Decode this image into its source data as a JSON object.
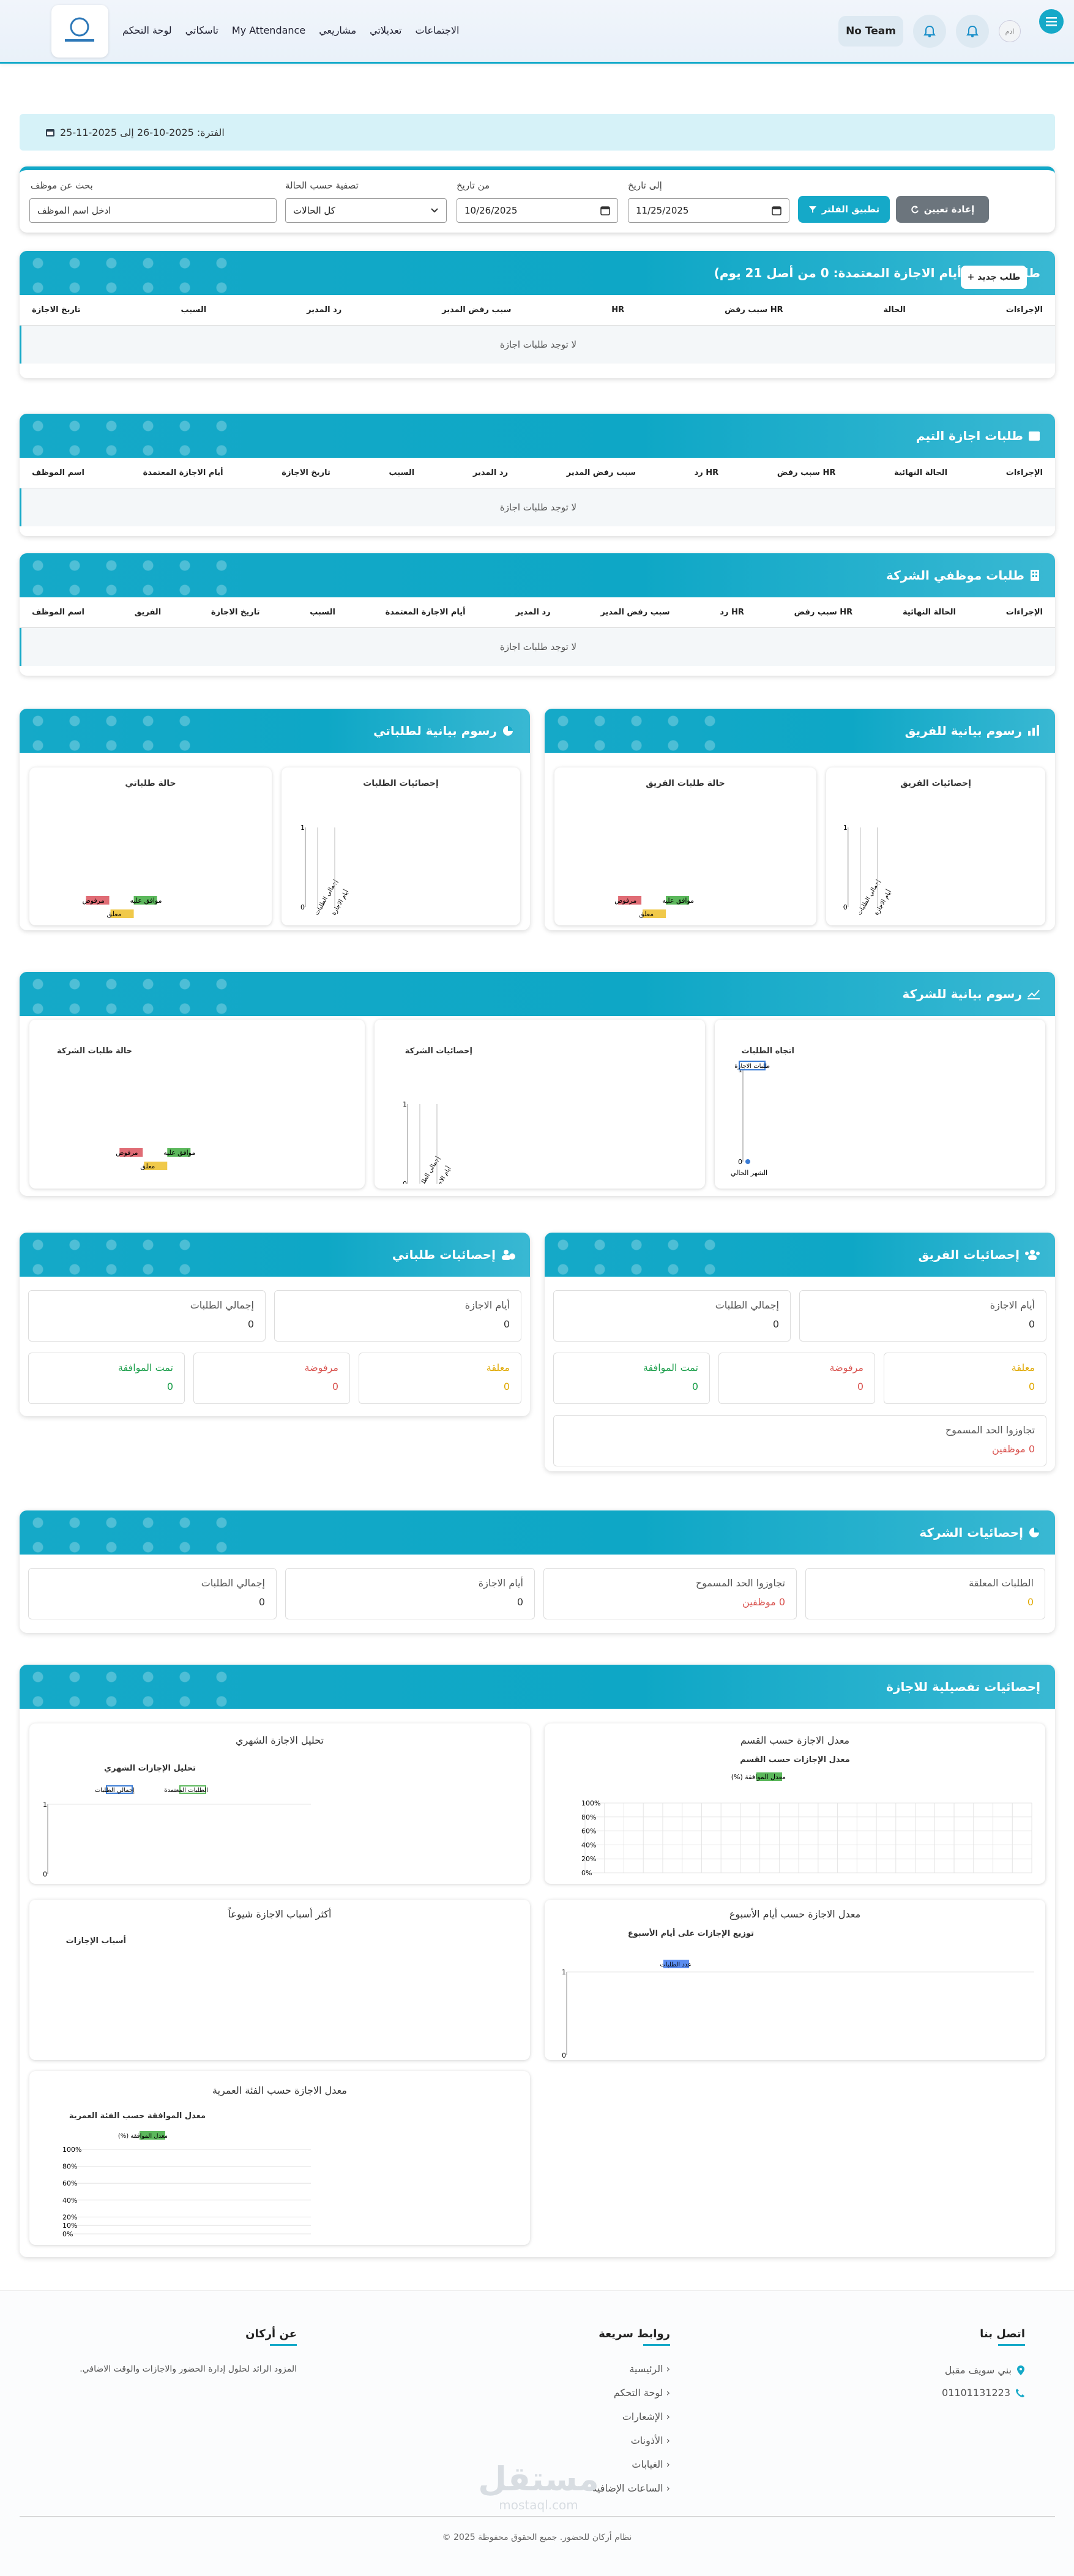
{
  "header": {
    "nav": [
      "الاجتماعات",
      "تعديلاتي",
      "مشاريعي",
      "My Attendance",
      "تاسكاتي",
      "لوحة التحكم"
    ],
    "team_label": "No Team",
    "user_initials": "ادم"
  },
  "period": "الفترة: 2025-10-26 إلى 2025-11-25",
  "filter": {
    "search_label": "بحث عن موظف",
    "search_placeholder": "ادخل اسم الموظف",
    "status_label": "تصفية حسب الحالة",
    "status_value": "كل الحالات",
    "from_label": "من تاريخ",
    "from_value": "10/26/2025",
    "to_label": "إلى تاريخ",
    "to_value": "11/25/2025",
    "apply": "تطبيق الفلتر",
    "reset": "إعادة تعيين"
  },
  "my_requests": {
    "title": "طلباتي (عدد أيام الاجازة المعتمدة: 0 من أصل 21 يوم)",
    "new_button": "طلب جديد +",
    "columns": [
      "الإجراءات",
      "الحالة",
      "HR سبب رفض",
      "HR",
      "سبب رفض المدير",
      "رد المدير",
      "السبب",
      "تاريخ الاجازة"
    ],
    "empty": "لا توجد طلبات اجازة"
  },
  "team_requests": {
    "title": "طلبات اجازة التيم",
    "columns": [
      "الإجراءات",
      "الحالة النهائية",
      "HR سبب رفض",
      "HR رد",
      "سبب رفض المدير",
      "رد المدير",
      "السبب",
      "تاريخ الاجازة",
      "أيام الاجازة المعتمدة",
      "اسم الموظف"
    ],
    "empty": "لا توجد طلبات اجازة"
  },
  "company_requests": {
    "title": "طلبات موظفي الشركة",
    "columns": [
      "الإجراءات",
      "الحالة النهائية",
      "HR سبب رفض",
      "HR رد",
      "سبب رفض المدير",
      "رد المدير",
      "أيام الاجازة المعتمدة",
      "السبب",
      "تاريخ الاجازة",
      "الفريق",
      "اسم الموظف"
    ],
    "empty": "لا توجد طلبات اجازة"
  },
  "charts_team": {
    "title": "رسوم بيانية للفريق",
    "stats_title": "إحصائيات الفريق",
    "status_title": "حالة طلبات الفريق"
  },
  "charts_mine": {
    "title": "رسوم بيانية لطلباتي",
    "stats_title": "إحصائيات الطلبات",
    "status_title": "حالة طلباتي"
  },
  "charts_company": {
    "title": "رسوم بيانية للشركة",
    "trend_title": "اتجاه الطلبات",
    "trend_legend": "طلبات الاجازة",
    "trend_xlabel": "الشهر الحالي",
    "stats_title": "إحصائيات الشركة",
    "status_title": "حالة طلبات الشركة"
  },
  "bar_labels": [
    "إجمالي الطلبات",
    "أيام الاجازة"
  ],
  "legend_status": {
    "approved": "موافق عليه",
    "rejected": "مرفوض",
    "pending": "معلق"
  },
  "team_stats": {
    "title": "إحصائيات الفريق",
    "days": "أيام الاجازة",
    "days_v": "0",
    "total": "إجمالي الطلبات",
    "total_v": "0",
    "pending": "معلقة",
    "pending_v": "0",
    "rejected": "مرفوضة",
    "rejected_v": "0",
    "approved": "تمت الموافقة",
    "approved_v": "0",
    "exceeded": "تجاوزوا الحد المسموح",
    "exceeded_v": "0 موظفين"
  },
  "my_stats": {
    "title": "إحصائيات طلباتي",
    "days": "أيام الاجازة",
    "days_v": "0",
    "total": "إجمالي الطلبات",
    "total_v": "0",
    "pending": "معلقة",
    "pending_v": "0",
    "rejected": "مرفوضة",
    "rejected_v": "0",
    "approved": "تمت الموافقة",
    "approved_v": "0"
  },
  "company_stats": {
    "title": "إحصائيات الشركة",
    "pending": "الطلبات المعلقة",
    "pending_v": "0",
    "exceeded": "تجاوزوا الحد المسموح",
    "exceeded_v": "0 موظفين",
    "days": "أيام الاجازة",
    "days_v": "0",
    "total": "إجمالي الطلبات",
    "total_v": "0"
  },
  "detailed": {
    "title": "إحصائيات تفصيلية للاجازة",
    "dept_title": "معدل الاجازة حسب القسم",
    "dept_chart_title": "معدل الإجازات حسب القسم",
    "dept_legend": "معدل الموافقة (%)",
    "monthly_title": "تحليل الاجازة الشهري",
    "monthly_chart_title": "تحليل الإجازات الشهري",
    "monthly_legend_a": "إجمالي الطلبات",
    "monthly_legend_b": "الطلبات المعتمدة",
    "weekday_title": "معدل الاجازة حسب أيام الأسبوع",
    "weekday_chart_title": "توزيع الإجازات على أيام الأسبوع",
    "weekday_legend": "عدد الطلبات",
    "reasons_title": "أكثر أسباب الاجازة شيوعاً",
    "reasons_chart_title": "أسباب الإجازات",
    "age_title": "معدل الاجازة حسب الفئة العمرية",
    "age_chart_title": "معدل الموافقة حسب الفئة العمرية",
    "age_legend": "معدل الموافقة (%)"
  },
  "chart_data": [
    {
      "type": "bar",
      "title": "إحصائيات الطلبات",
      "categories": [
        "إجمالي الطلبات",
        "أيام الاجازة"
      ],
      "values": [
        0,
        0
      ],
      "ylim": [
        0,
        1
      ]
    },
    {
      "type": "pie",
      "title": "حالة طلباتي",
      "categories": [
        "موافق عليه",
        "مرفوض",
        "معلق"
      ],
      "values": [
        0,
        0,
        0
      ]
    },
    {
      "type": "bar",
      "title": "إحصائيات الفريق",
      "categories": [
        "إجمالي الطلبات",
        "أيام الاجازة"
      ],
      "values": [
        0,
        0
      ],
      "ylim": [
        0,
        1
      ]
    },
    {
      "type": "pie",
      "title": "حالة طلبات الفريق",
      "categories": [
        "موافق عليه",
        "مرفوض",
        "معلق"
      ],
      "values": [
        0,
        0,
        0
      ]
    },
    {
      "type": "line",
      "title": "اتجاه الطلبات",
      "categories": [
        "الشهر الحالي"
      ],
      "series": [
        {
          "name": "طلبات الاجازة",
          "values": [
            0
          ]
        }
      ],
      "ylim": [
        0,
        1
      ]
    },
    {
      "type": "bar",
      "title": "إحصائيات الشركة",
      "categories": [
        "إجمالي الطلبات",
        "أيام الاجازة"
      ],
      "values": [
        0,
        0
      ],
      "ylim": [
        0,
        1
      ]
    },
    {
      "type": "pie",
      "title": "حالة طلبات الشركة",
      "categories": [
        "موافق عليه",
        "مرفوض",
        "معلق"
      ],
      "values": [
        0,
        0,
        0
      ]
    },
    {
      "type": "bar",
      "title": "معدل الإجازات حسب القسم",
      "series": [
        {
          "name": "معدل الموافقة (%)",
          "values": [
            0,
            0,
            0,
            0,
            0,
            0,
            0,
            0,
            0,
            0,
            0,
            0,
            0,
            0,
            0,
            0,
            0,
            0,
            0,
            0,
            0,
            0,
            0
          ]
        }
      ],
      "ylim": [
        0,
        100
      ],
      "yticks": [
        "0%",
        "20%",
        "40%",
        "60%",
        "80%",
        "100%"
      ]
    },
    {
      "type": "bar",
      "title": "تحليل الإجازات الشهري",
      "series": [
        {
          "name": "إجمالي الطلبات",
          "values": []
        },
        {
          "name": "الطلبات المعتمدة",
          "values": []
        }
      ],
      "ylim": [
        0,
        1
      ]
    },
    {
      "type": "bar",
      "title": "توزيع الإجازات على أيام الأسبوع",
      "series": [
        {
          "name": "عدد الطلبات",
          "values": []
        }
      ],
      "ylim": [
        0,
        1
      ]
    },
    {
      "type": "pie",
      "title": "أسباب الإجازات",
      "categories": [],
      "values": []
    },
    {
      "type": "bar",
      "title": "معدل الموافقة حسب الفئة العمرية",
      "series": [
        {
          "name": "معدل الموافقة (%)",
          "values": []
        }
      ],
      "ylim": [
        0,
        100
      ],
      "yticks": [
        "0%",
        "10%",
        "20%",
        "40%",
        "60%",
        "80%",
        "100%"
      ]
    }
  ],
  "footer": {
    "contact_title": "اتصل بنا",
    "address": "بني سويف مقبل",
    "phone": "01101131223",
    "links_title": "روابط سريعة",
    "links": [
      "الرئيسية",
      "لوحة التحكم",
      "الإشعارات",
      "الأذونات",
      "الغيابات",
      "الساعات الإضافية"
    ],
    "about_title": "عن أركان",
    "about_text": "المزود الرائد لحلول إدارة الحضور والاجازات والوقت الاضافي.",
    "watermark": "مستقل",
    "watermark_sub": "mostaql.com",
    "copyright": "نظام أركان للحضور. جميع الحقوق محفوظة 2025 ©"
  },
  "colors": {
    "accent": "#15a9c8",
    "approved": "#5cb85c",
    "rejected": "#e06c75",
    "pending": "#f0c94a",
    "reset": "#6c757d"
  }
}
